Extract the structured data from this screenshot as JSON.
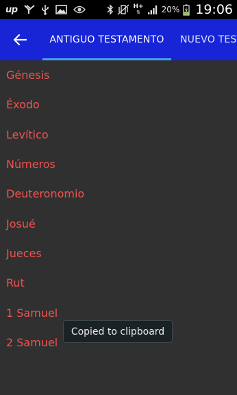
{
  "status_bar": {
    "left_icons": [
      "up-icon",
      "y-logo-icon",
      "usb-icon",
      "image-icon",
      "eye-icon"
    ],
    "up_text": "up",
    "battery_percent": "20%",
    "network_type": "H+",
    "time": "19:06"
  },
  "app_bar": {
    "back_icon": "arrow-left-icon",
    "tabs": [
      {
        "label": "ANTIGUO TESTAMENTO",
        "active": true
      },
      {
        "label": "NUEVO TESTAMENTO",
        "active": false
      }
    ]
  },
  "books": [
    {
      "label": "Génesis"
    },
    {
      "label": "Éxodo"
    },
    {
      "label": "Levítico"
    },
    {
      "label": "Números"
    },
    {
      "label": "Deuteronomio"
    },
    {
      "label": "Josué"
    },
    {
      "label": "Jueces"
    },
    {
      "label": "Rut"
    },
    {
      "label": "1 Samuel"
    },
    {
      "label": "2 Samuel"
    }
  ],
  "toast": {
    "text": "Copied to clipboard"
  },
  "colors": {
    "app_bar": "#1725d6",
    "tab_indicator": "#42a5f5",
    "book_text": "#ef5350",
    "background": "#303030"
  }
}
